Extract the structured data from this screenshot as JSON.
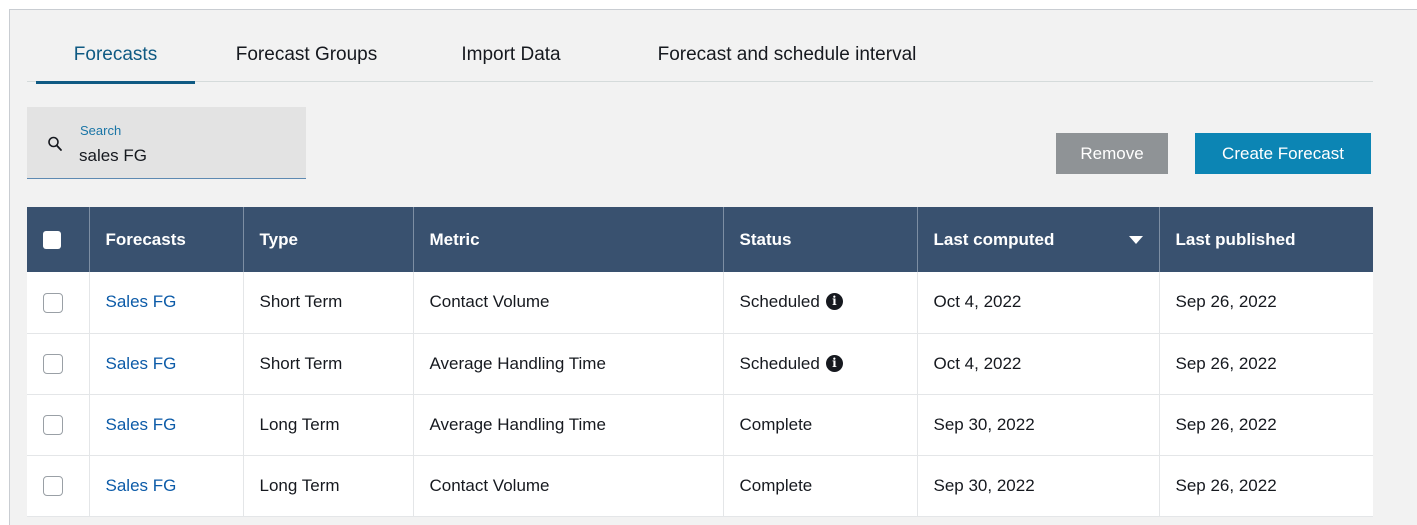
{
  "tabs": [
    {
      "label": "Forecasts",
      "active": true
    },
    {
      "label": "Forecast Groups",
      "active": false
    },
    {
      "label": "Import Data",
      "active": false
    },
    {
      "label": "Forecast and schedule interval",
      "active": false
    }
  ],
  "search": {
    "label": "Search",
    "value": "sales FG",
    "icon": "search-icon"
  },
  "buttons": {
    "remove": "Remove",
    "create": "Create Forecast"
  },
  "table": {
    "headers": [
      "Forecasts",
      "Type",
      "Metric",
      "Status",
      "Last computed",
      "Last published"
    ],
    "rows": [
      {
        "forecast": "Sales FG",
        "type": "Short Term",
        "metric": "Contact Volume",
        "status": "Scheduled",
        "status_info": true,
        "last_computed": "Oct 4, 2022",
        "last_published": "Sep 26, 2022"
      },
      {
        "forecast": "Sales FG",
        "type": "Short Term",
        "metric": "Average Handling Time",
        "status": "Scheduled",
        "status_info": true,
        "last_computed": "Oct 4, 2022",
        "last_published": "Sep 26, 2022"
      },
      {
        "forecast": "Sales FG",
        "type": "Long Term",
        "metric": "Average Handling Time",
        "status": "Complete",
        "status_info": false,
        "last_computed": "Sep 30, 2022",
        "last_published": "Sep 26, 2022"
      },
      {
        "forecast": "Sales FG",
        "type": "Long Term",
        "metric": "Contact Volume",
        "status": "Complete",
        "status_info": false,
        "last_computed": "Sep 30, 2022",
        "last_published": "Sep 26, 2022"
      }
    ]
  },
  "colors": {
    "accent": "#0f5a83",
    "header_bg": "#39516f",
    "create_button": "#0c85b4",
    "remove_button": "#8f9396",
    "link": "#0c5ba8"
  }
}
